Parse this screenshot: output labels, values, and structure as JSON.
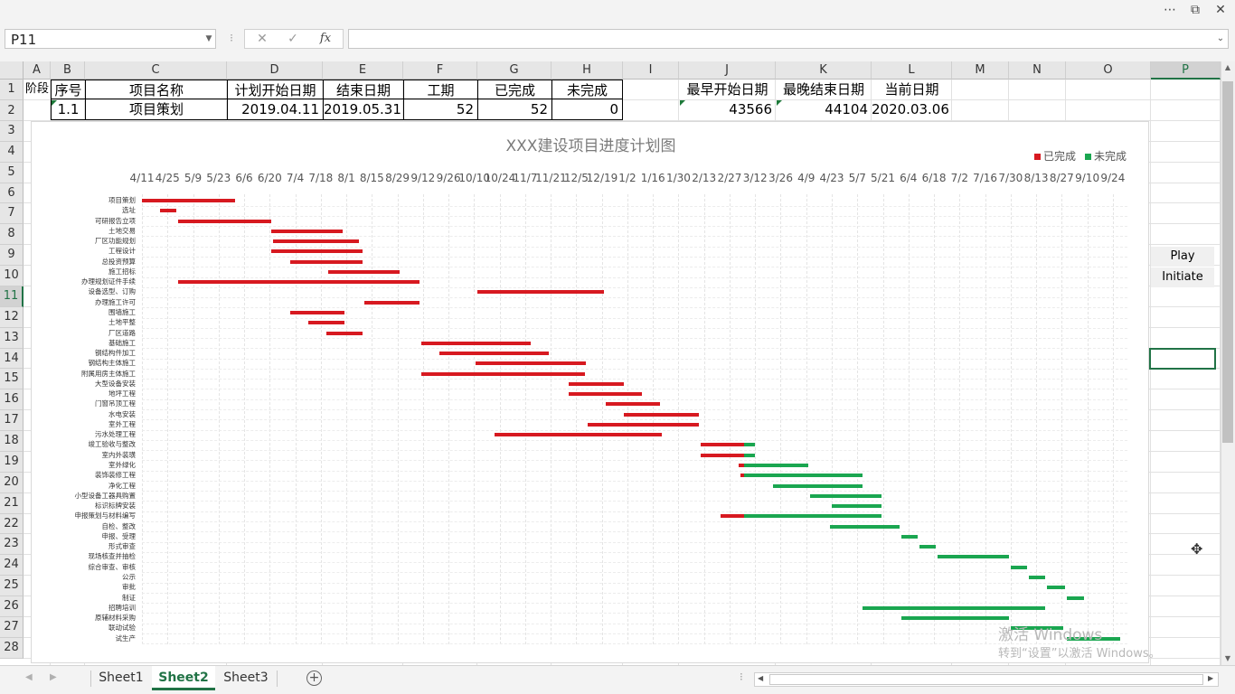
{
  "window": {
    "more_icon": "more-horizontal-icon",
    "restore_icon": "restore-window-icon",
    "close_icon": "close-icon"
  },
  "formula_bar": {
    "name_box": "P11",
    "cancel_symbol": "✕",
    "enter_symbol": "✓",
    "fx_symbol": "fx",
    "content": ""
  },
  "columns": [
    "A",
    "B",
    "C",
    "D",
    "E",
    "F",
    "G",
    "H",
    "I",
    "J",
    "K",
    "L",
    "M",
    "N",
    "O",
    "P"
  ],
  "rows": [
    "1",
    "2",
    "3",
    "4",
    "5",
    "6",
    "7",
    "8",
    "9",
    "10",
    "11",
    "12",
    "13",
    "14",
    "15",
    "16",
    "17",
    "18",
    "19",
    "20",
    "21",
    "22",
    "23",
    "24",
    "25",
    "26",
    "27",
    "28"
  ],
  "header_row": {
    "A": "阶段",
    "B": "序号",
    "C": "项目名称",
    "D": "计划开始日期",
    "E": "结束日期",
    "F": "工期",
    "G": "已完成",
    "H": "未完成",
    "J": "最早开始日期",
    "K": "最晚结束日期",
    "L": "当前日期"
  },
  "data_row": {
    "B": "1.1",
    "C": "项目策划",
    "D": "2019.04.11",
    "E": "2019.05.31",
    "F": "52",
    "G": "52",
    "H": "0",
    "J": "43566",
    "K": "44104",
    "L": "2020.03.06"
  },
  "side_cells": {
    "P9": "Play",
    "P10": "Initiate"
  },
  "colors": {
    "completed": "#d71920",
    "remaining": "#1aa650",
    "excel_green": "#217346"
  },
  "chart_data": {
    "type": "bar",
    "title": "XXX建设项目进度计划图",
    "legend": [
      "已完成",
      "未完成"
    ],
    "legend_position": "top-right",
    "x_ticks": [
      "4/11",
      "4/25",
      "5/9",
      "5/23",
      "6/6",
      "6/20",
      "7/4",
      "7/18",
      "8/1",
      "8/15",
      "8/29",
      "9/12",
      "9/26",
      "10/10",
      "10/24",
      "11/7",
      "11/21",
      "12/5",
      "12/19",
      "1/2",
      "1/16",
      "1/30",
      "2/13",
      "2/27",
      "3/12",
      "3/26",
      "4/9",
      "4/23",
      "5/7",
      "5/21",
      "6/4",
      "6/18",
      "7/2",
      "7/16",
      "7/30",
      "8/13",
      "8/27",
      "9/10",
      "9/24"
    ],
    "x_range": [
      "2019-04-11",
      "2020-10-01"
    ],
    "status_date": "2020-03-06",
    "tasks": [
      {
        "name": "项目策划",
        "start": "2019-04-11",
        "end": "2019-06-01"
      },
      {
        "name": "选址",
        "start": "2019-04-21",
        "end": "2019-04-30"
      },
      {
        "name": "可研报告立项",
        "start": "2019-05-01",
        "end": "2019-06-21"
      },
      {
        "name": "土地交易",
        "start": "2019-06-21",
        "end": "2019-07-30"
      },
      {
        "name": "厂区功能规划",
        "start": "2019-06-22",
        "end": "2019-08-08"
      },
      {
        "name": "工程设计",
        "start": "2019-06-21",
        "end": "2019-08-10"
      },
      {
        "name": "总投资预算",
        "start": "2019-07-01",
        "end": "2019-08-10"
      },
      {
        "name": "施工招标",
        "start": "2019-07-22",
        "end": "2019-08-30"
      },
      {
        "name": "办理规划证件手续",
        "start": "2019-05-01",
        "end": "2019-09-10"
      },
      {
        "name": "设备选型、订购",
        "start": "2019-10-12",
        "end": "2019-12-20"
      },
      {
        "name": "办理施工许可",
        "start": "2019-08-11",
        "end": "2019-09-10"
      },
      {
        "name": "围墙施工",
        "start": "2019-07-01",
        "end": "2019-07-31"
      },
      {
        "name": "土地平整",
        "start": "2019-07-11",
        "end": "2019-07-31"
      },
      {
        "name": "厂区道路",
        "start": "2019-07-21",
        "end": "2019-08-10"
      },
      {
        "name": "基础施工",
        "start": "2019-09-11",
        "end": "2019-11-10"
      },
      {
        "name": "钢结构件加工",
        "start": "2019-09-21",
        "end": "2019-11-20"
      },
      {
        "name": "钢结构主体施工",
        "start": "2019-10-11",
        "end": "2019-12-10"
      },
      {
        "name": "附属用房主体施工",
        "start": "2019-09-11",
        "end": "2019-12-10"
      },
      {
        "name": "大型设备安装",
        "start": "2019-12-01",
        "end": "2019-12-31"
      },
      {
        "name": "地坪工程",
        "start": "2019-12-01",
        "end": "2020-01-10"
      },
      {
        "name": "门窗吊顶工程",
        "start": "2019-12-21",
        "end": "2020-01-20"
      },
      {
        "name": "水电安装",
        "start": "2019-12-31",
        "end": "2020-02-10"
      },
      {
        "name": "室外工程",
        "start": "2019-12-11",
        "end": "2020-02-10"
      },
      {
        "name": "污水处理工程",
        "start": "2019-10-21",
        "end": "2020-01-21"
      },
      {
        "name": "竣工验收与整改",
        "start": "2020-02-11",
        "end": "2020-03-12"
      },
      {
        "name": "室内外装璜",
        "start": "2020-02-11",
        "end": "2020-03-12"
      },
      {
        "name": "室外绿化",
        "start": "2020-03-03",
        "end": "2020-04-10"
      },
      {
        "name": "装饰装修工程",
        "start": "2020-03-04",
        "end": "2020-05-10"
      },
      {
        "name": "净化工程",
        "start": "2020-03-22",
        "end": "2020-05-10"
      },
      {
        "name": "小型设备工器具购置",
        "start": "2020-04-11",
        "end": "2020-05-20"
      },
      {
        "name": "标识标牌安装",
        "start": "2020-04-23",
        "end": "2020-05-20"
      },
      {
        "name": "申报策划与材料编写",
        "start": "2020-02-22",
        "end": "2020-05-20"
      },
      {
        "name": "自检、整改",
        "start": "2020-04-22",
        "end": "2020-05-30"
      },
      {
        "name": "申报、受理",
        "start": "2020-05-31",
        "end": "2020-06-09"
      },
      {
        "name": "形式审查",
        "start": "2020-06-10",
        "end": "2020-06-19"
      },
      {
        "name": "现场核查并抽检",
        "start": "2020-06-20",
        "end": "2020-07-29"
      },
      {
        "name": "综合审查、审核",
        "start": "2020-07-30",
        "end": "2020-08-08"
      },
      {
        "name": "公示",
        "start": "2020-08-09",
        "end": "2020-08-18"
      },
      {
        "name": "审批",
        "start": "2020-08-19",
        "end": "2020-08-29"
      },
      {
        "name": "制证",
        "start": "2020-08-30",
        "end": "2020-09-08"
      },
      {
        "name": "招聘培训",
        "start": "2020-05-10",
        "end": "2020-08-18"
      },
      {
        "name": "原辅材料采购",
        "start": "2020-05-31",
        "end": "2020-07-29"
      },
      {
        "name": "联动试验",
        "start": "2020-07-30",
        "end": "2020-08-28"
      },
      {
        "name": "试生产",
        "start": "2020-08-30",
        "end": "2020-09-28"
      }
    ]
  },
  "watermark": {
    "line1": "激活 Windows",
    "line2": "转到“设置”以激活 Windows。"
  },
  "sheets": {
    "tabs": [
      "Sheet1",
      "Sheet2",
      "Sheet3"
    ],
    "active": "Sheet2",
    "add_symbol": "+"
  }
}
